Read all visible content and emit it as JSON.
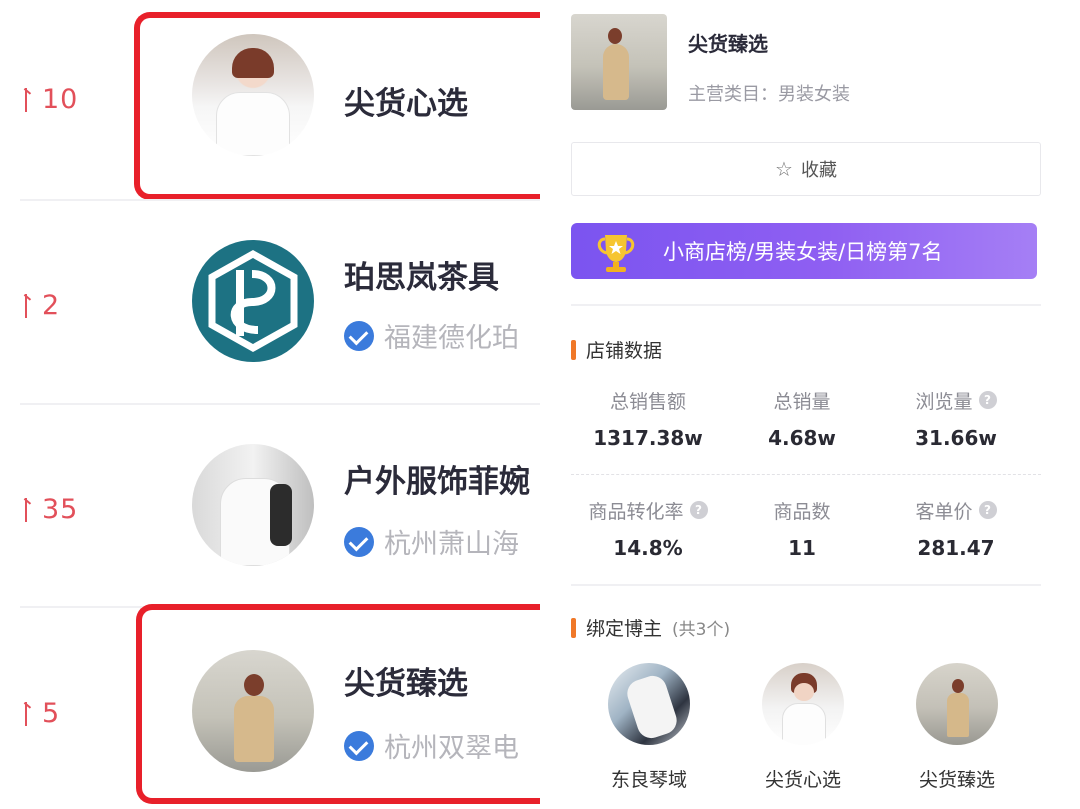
{
  "left_list": {
    "rows": [
      {
        "rank_change": "10",
        "name": "尖货心选",
        "subtitle": "",
        "verified": false,
        "highlighted": true
      },
      {
        "rank_change": "2",
        "name": "珀思岚茶具",
        "subtitle": "福建德化珀",
        "verified": true,
        "highlighted": false
      },
      {
        "rank_change": "35",
        "name": "户外服饰菲婉",
        "subtitle": "杭州萧山海",
        "verified": true,
        "highlighted": false
      },
      {
        "rank_change": "5",
        "name": "尖货臻选",
        "subtitle": "杭州双翠电",
        "verified": true,
        "highlighted": true
      }
    ],
    "rank_color": "#e2505a",
    "highlight_color": "#e8202a"
  },
  "shop": {
    "name": "尖货臻选",
    "category": "主营类目：男装女装",
    "favorite_label": "收藏",
    "rank_banner": "小商店榜/男装女装/日榜第7名"
  },
  "store_data": {
    "title": "店铺数据",
    "stats": [
      {
        "label": "总销售额",
        "value": "1317.38w",
        "help": false
      },
      {
        "label": "总销量",
        "value": "4.68w",
        "help": false
      },
      {
        "label": "浏览量",
        "value": "31.66w",
        "help": true
      },
      {
        "label": "商品转化率",
        "value": "14.8%",
        "help": true
      },
      {
        "label": "商品数",
        "value": "11",
        "help": false
      },
      {
        "label": "客单价",
        "value": "281.47",
        "help": true
      }
    ]
  },
  "bloggers": {
    "title": "绑定博主",
    "count": "(共3个)",
    "items": [
      {
        "name": "东良琴域"
      },
      {
        "name": "尖货心选"
      },
      {
        "name": "尖货臻选"
      }
    ]
  },
  "colors": {
    "accent_orange": "#f07828",
    "banner_purple": "#7b54f0",
    "verified_blue": "#3b7bdc"
  }
}
